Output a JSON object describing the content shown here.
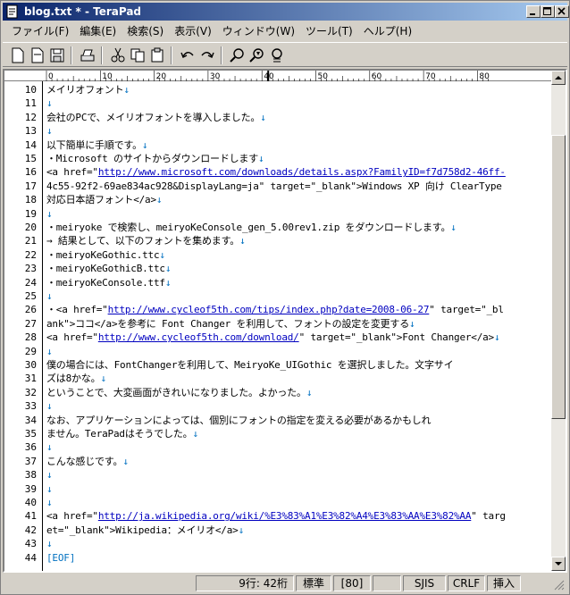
{
  "window": {
    "title": "blog.txt * - TeraPad"
  },
  "menu": [
    "ファイル(F)",
    "編集(E)",
    "検索(S)",
    "表示(V)",
    "ウィンドウ(W)",
    "ツール(T)",
    "ヘルプ(H)"
  ],
  "toolbar": [
    "new-file",
    "open-file",
    "save-file",
    "print",
    "cut",
    "copy",
    "paste",
    "undo",
    "redo",
    "find",
    "find-next",
    "replace"
  ],
  "ruler": [
    "0",
    "10",
    "20",
    "30",
    "40",
    "50",
    "60",
    "70",
    "80"
  ],
  "newline_mark": "↓",
  "lines": [
    {
      "n": "10",
      "t": "メイリオフォント",
      "nl": true
    },
    {
      "n": "11",
      "t": "",
      "nl": true
    },
    {
      "n": "12",
      "t": "会社のPCで、メイリオフォントを導入しました。",
      "nl": true
    },
    {
      "n": "13",
      "t": "",
      "nl": true
    },
    {
      "n": "14",
      "t": "以下簡単に手順です。",
      "nl": true
    },
    {
      "n": "15",
      "t": "・Microsoft のサイトからダウンロードします",
      "nl": true
    },
    {
      "n": "16",
      "t": "<a href=\"",
      "u": "http://www.microsoft.com/downloads/details.aspx?FamilyID=f7d758d2-46ff-",
      "t2": "",
      "nl": false
    },
    {
      "n": "17",
      "t": "4c55-92f2-69ae834ac928&DisplayLang=ja\" target=\"_blank\">Windows XP 向け ClearType",
      "nl": false
    },
    {
      "n": "18",
      "t": " 対応日本語フォント</a>",
      "nl": true
    },
    {
      "n": "19",
      "t": "",
      "nl": true
    },
    {
      "n": "20",
      "t": "・meiryoke で検索し、meiryoKeConsole_gen_5.00rev1.zip をダウンロードします。",
      "nl": true
    },
    {
      "n": "21",
      "t": "→ 結果として、以下のフォントを集めます。",
      "nl": true
    },
    {
      "n": "22",
      "t": "  ・meiryoKeGothic.ttc",
      "nl": true
    },
    {
      "n": "23",
      "t": "  ・meiryoKeGothicB.ttc",
      "nl": true
    },
    {
      "n": "24",
      "t": "  ・meiryoKeConsole.ttf",
      "nl": true
    },
    {
      "n": "25",
      "t": "",
      "nl": true
    },
    {
      "n": "26",
      "t": "・<a href=\"",
      "u": "http://www.cycleof5th.com/tips/index.php?date=2008-06-27",
      "t2": "\" target=\"_bl",
      "nl": false
    },
    {
      "n": "27",
      "t": "ank\">ココ</a>を参考に Font Changer を利用して、フォントの設定を変更する",
      "nl": true
    },
    {
      "n": "28",
      "t": "<a href=\"",
      "u": "http://www.cycleof5th.com/download/",
      "t2": "\" target=\"_blank\">Font Changer</a>",
      "nl": true
    },
    {
      "n": "29",
      "t": "",
      "nl": true
    },
    {
      "n": "30",
      "t": "僕の場合には、FontChangerを利用して、MeiryoKe_UIGothic を選択しました。文字サイ",
      "nl": false
    },
    {
      "n": "31",
      "t": "ズは8かな。",
      "nl": true
    },
    {
      "n": "32",
      "t": "ということで、大変画面がきれいになりました。よかった。",
      "nl": true
    },
    {
      "n": "33",
      "t": "",
      "nl": true
    },
    {
      "n": "34",
      "t": "なお、アプリケーションによっては、個別にフォントの指定を変える必要があるかもしれ",
      "nl": false
    },
    {
      "n": "35",
      "t": "ません。TeraPadはそうでした。",
      "nl": true
    },
    {
      "n": "36",
      "t": "",
      "nl": true
    },
    {
      "n": "37",
      "t": "こんな感じです。",
      "nl": true
    },
    {
      "n": "38",
      "t": "",
      "nl": true
    },
    {
      "n": "39",
      "t": "",
      "nl": true
    },
    {
      "n": "40",
      "t": "",
      "nl": true
    },
    {
      "n": "41",
      "t": "<a href=\"",
      "u": "http://ja.wikipedia.org/wiki/%E3%83%A1%E3%82%A4%E3%83%AA%E3%82%AA",
      "t2": "\" targ",
      "nl": false
    },
    {
      "n": "42",
      "t": "et=\"_blank\">Wikipedia：メイリオ</a>",
      "nl": true
    },
    {
      "n": "43",
      "t": "",
      "nl": true
    },
    {
      "n": "44",
      "t": "",
      "eof": "[EOF]",
      "nl": false
    }
  ],
  "status": {
    "position": "9行:  42桁",
    "mode": "標準",
    "wrap": "[80]",
    "blank": "",
    "encoding": "SJIS",
    "newline": "CRLF",
    "insert": "挿入"
  }
}
